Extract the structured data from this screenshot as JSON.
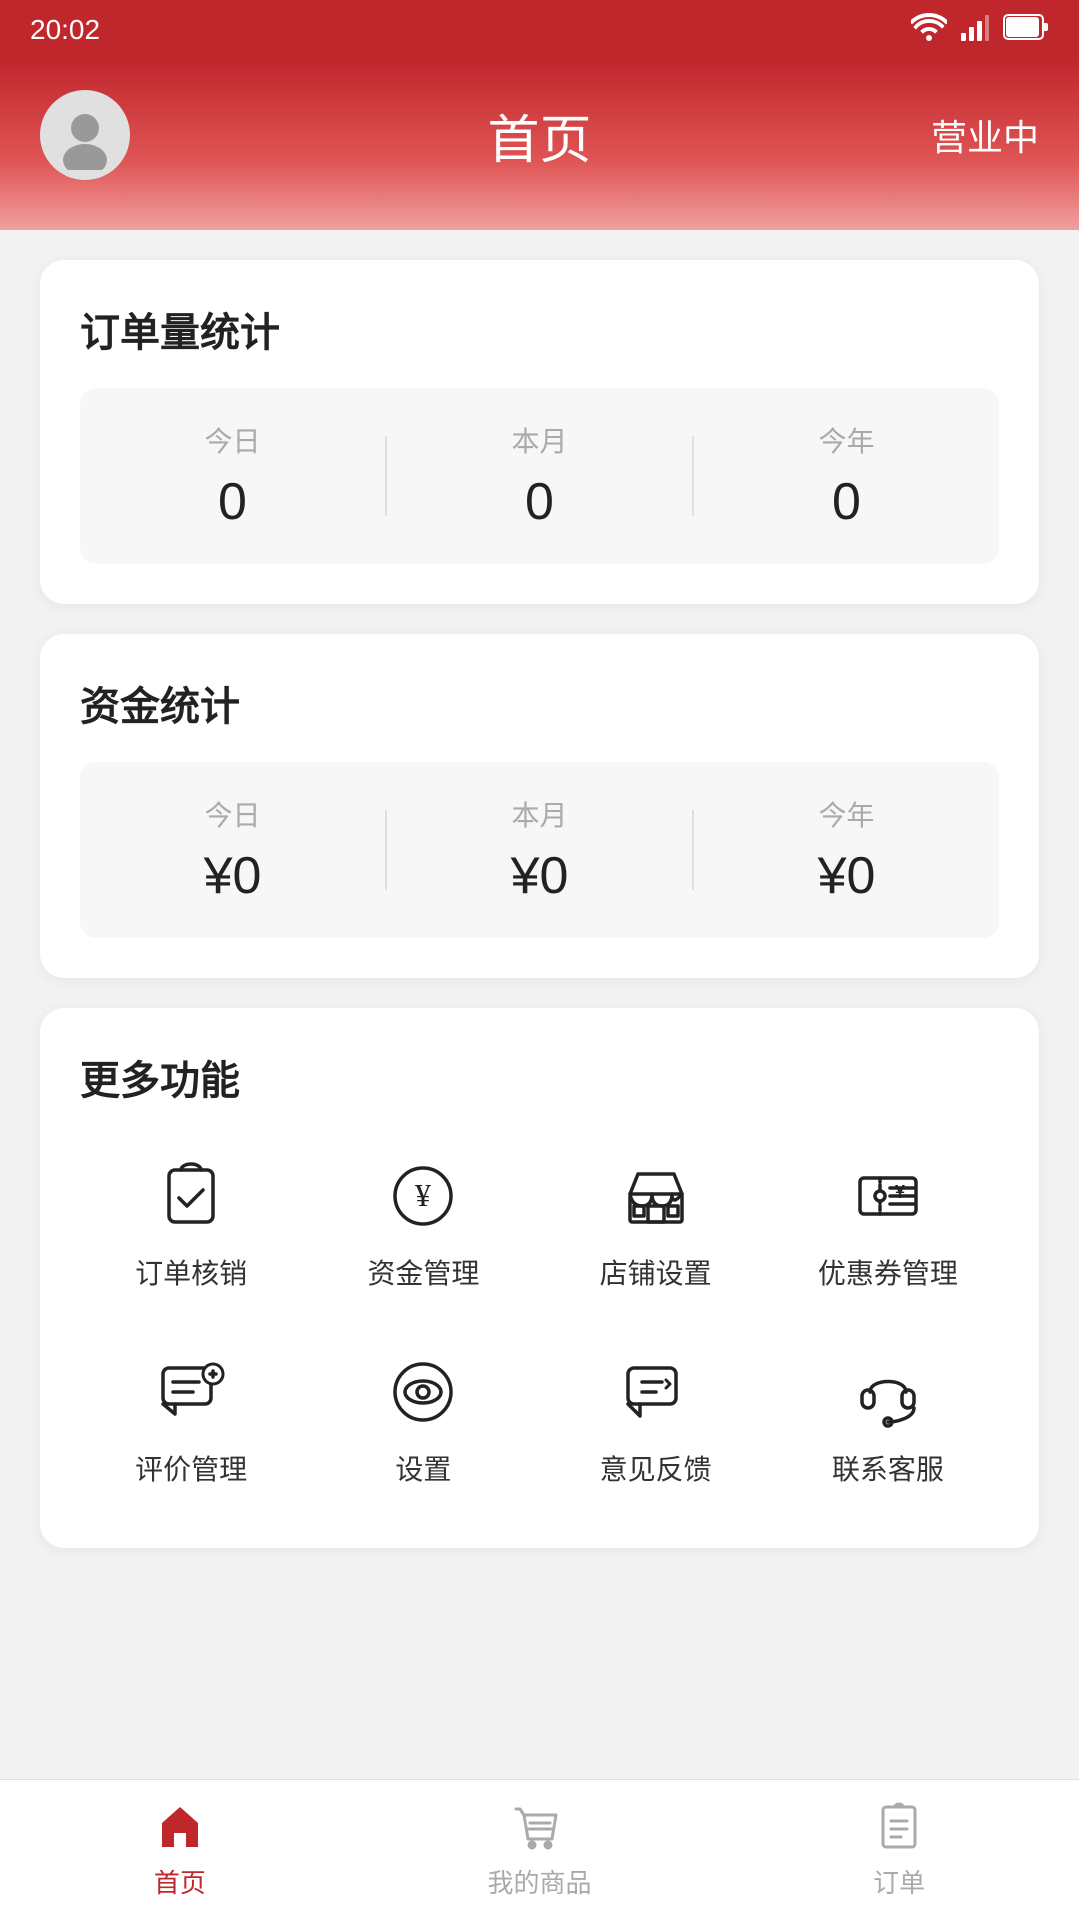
{
  "statusBar": {
    "time": "20:02",
    "timeLabel": "time"
  },
  "header": {
    "title": "首页",
    "statusLabel": "营业中",
    "avatarAlt": "user avatar"
  },
  "orderStats": {
    "title": "订单量统计",
    "items": [
      {
        "label": "今日",
        "value": "0"
      },
      {
        "label": "本月",
        "value": "0"
      },
      {
        "label": "今年",
        "value": "0"
      }
    ]
  },
  "fundStats": {
    "title": "资金统计",
    "items": [
      {
        "label": "今日",
        "value": "¥0"
      },
      {
        "label": "本月",
        "value": "¥0"
      },
      {
        "label": "今年",
        "value": "¥0"
      }
    ]
  },
  "features": {
    "title": "更多功能",
    "items": [
      {
        "id": "order-cancel",
        "label": "订单核销",
        "icon": "clipboard-check"
      },
      {
        "id": "fund-mgmt",
        "label": "资金管理",
        "icon": "yen-circle"
      },
      {
        "id": "store-settings",
        "label": "店铺设置",
        "icon": "store"
      },
      {
        "id": "coupon-mgmt",
        "label": "优惠券管理",
        "icon": "coupon"
      },
      {
        "id": "review-mgmt",
        "label": "评价管理",
        "icon": "review"
      },
      {
        "id": "settings",
        "label": "设置",
        "icon": "eye-circle"
      },
      {
        "id": "feedback",
        "label": "意见反馈",
        "icon": "feedback"
      },
      {
        "id": "customer-service",
        "label": "联系客服",
        "icon": "headset"
      }
    ]
  },
  "bottomNav": {
    "items": [
      {
        "id": "home",
        "label": "首页",
        "active": true
      },
      {
        "id": "products",
        "label": "我的商品",
        "active": false
      },
      {
        "id": "orders",
        "label": "订单",
        "active": false
      }
    ]
  }
}
